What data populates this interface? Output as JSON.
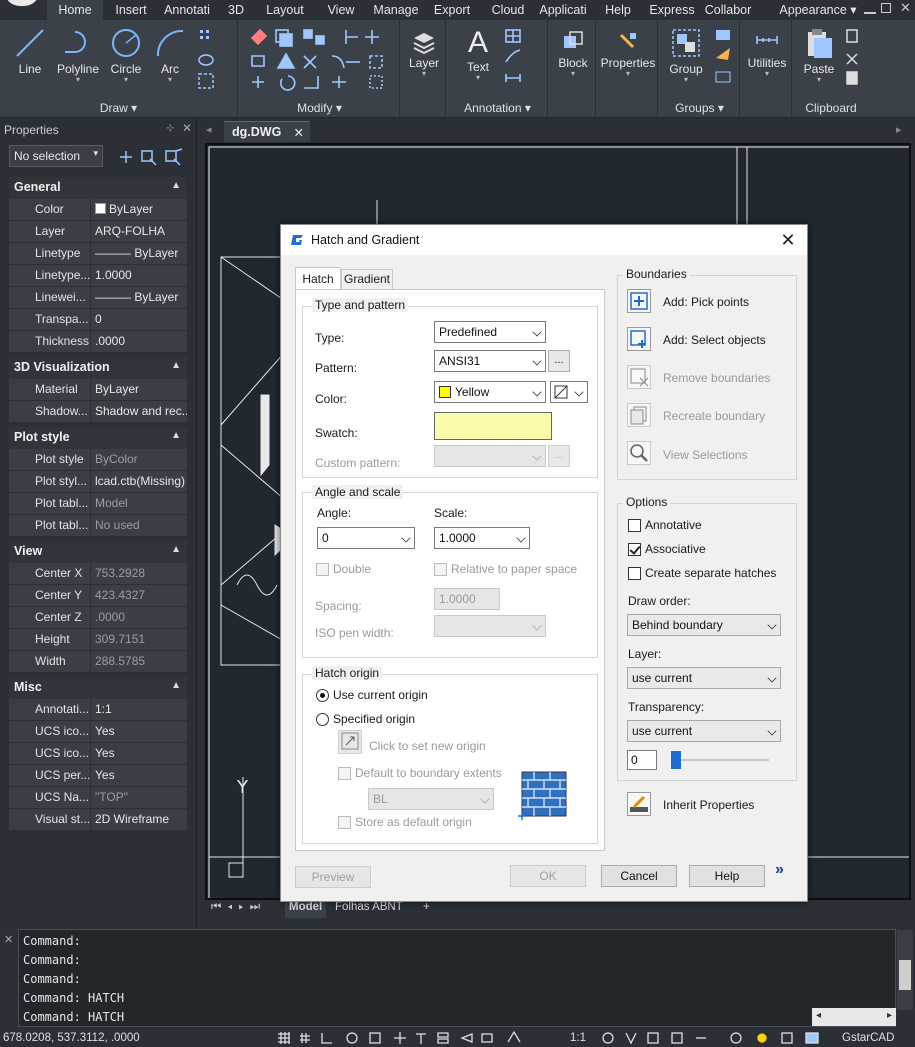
{
  "menu": {
    "tabs": [
      "Home",
      "Insert",
      "Annotati",
      "3D",
      "Layout",
      "View",
      "Manage",
      "Export",
      "Cloud",
      "Applicati",
      "Help",
      "Express",
      "Collabor"
    ],
    "appearance": "Appearance"
  },
  "ribbon": {
    "draw": {
      "label": "Draw",
      "tools": [
        "Line",
        "Polyline",
        "Circle",
        "Arc"
      ]
    },
    "modify": {
      "label": "Modify"
    },
    "layer": "Layer",
    "annotation": {
      "label": "Annotation",
      "text": "Text"
    },
    "block": "Block",
    "properties": "Properties",
    "groups": {
      "label": "Groups",
      "group": "Group"
    },
    "utilities": "Utilities",
    "clipboard": {
      "label": "Clipboard",
      "paste": "Paste"
    }
  },
  "properties_palette": {
    "title": "Properties",
    "selection": "No selection",
    "sections": [
      {
        "title": "General",
        "rows": [
          {
            "k": "Color",
            "v": "ByLayer",
            "swatch": "#ffffff"
          },
          {
            "k": "Layer",
            "v": "ARQ-FOLHA"
          },
          {
            "k": "Linetype",
            "v": "——— ByLayer"
          },
          {
            "k": "Linetype...",
            "v": "1.0000"
          },
          {
            "k": "Linewei...",
            "v": "——— ByLayer"
          },
          {
            "k": "Transpa...",
            "v": "0"
          },
          {
            "k": "Thickness",
            "v": ".0000"
          }
        ]
      },
      {
        "title": "3D Visualization",
        "rows": [
          {
            "k": "Material",
            "v": "ByLayer"
          },
          {
            "k": "Shadow...",
            "v": "Shadow and rec..."
          }
        ]
      },
      {
        "title": "Plot style",
        "rows": [
          {
            "k": "Plot style",
            "v": "ByColor",
            "dim": true
          },
          {
            "k": "Plot styl...",
            "v": "lcad.ctb(Missing)"
          },
          {
            "k": "Plot tabl...",
            "v": "Model",
            "dim": true
          },
          {
            "k": "Plot tabl...",
            "v": "No used",
            "dim": true
          }
        ]
      },
      {
        "title": "View",
        "rows": [
          {
            "k": "Center X",
            "v": "753.2928",
            "dim": true
          },
          {
            "k": "Center Y",
            "v": "423.4327",
            "dim": true
          },
          {
            "k": "Center Z",
            "v": ".0000",
            "dim": true
          },
          {
            "k": "Height",
            "v": "309.7151",
            "dim": true
          },
          {
            "k": "Width",
            "v": "288.5785",
            "dim": true
          }
        ]
      },
      {
        "title": "Misc",
        "rows": [
          {
            "k": "Annotati...",
            "v": "1:1"
          },
          {
            "k": "UCS ico...",
            "v": "Yes"
          },
          {
            "k": "UCS ico...",
            "v": "Yes"
          },
          {
            "k": "UCS per...",
            "v": "Yes"
          },
          {
            "k": "UCS Na...",
            "v": "\"TOP\"",
            "dim": true
          },
          {
            "k": "Visual st...",
            "v": "2D Wireframe"
          }
        ]
      }
    ]
  },
  "document": {
    "tab": "dg.DWG",
    "axis_label": "Y"
  },
  "layout_tabs": [
    "Model",
    "Folhas ABNT",
    "+"
  ],
  "command_lines": [
    "Command:",
    "Command:",
    "Command:",
    "Command: HATCH",
    "Command: HATCH"
  ],
  "status": {
    "coords": "678.0208, 537.3112, .0000",
    "scale": "1:1",
    "app": "GstarCAD"
  },
  "dialog": {
    "title": "Hatch and Gradient",
    "tabs": [
      "Hatch",
      "Gradient"
    ],
    "type_pattern": {
      "title": "Type and pattern",
      "type_label": "Type:",
      "type_value": "Predefined",
      "pattern_label": "Pattern:",
      "pattern_value": "ANSI31",
      "browse": "...",
      "color_label": "Color:",
      "color_value": "Yellow",
      "color_hex": "#ffff00",
      "swatch_label": "Swatch:",
      "custom_label": "Custom pattern:"
    },
    "angle_scale": {
      "title": "Angle and scale",
      "angle_label": "Angle:",
      "angle_value": "0",
      "scale_label": "Scale:",
      "scale_value": "1.0000",
      "double": "Double",
      "relative": "Relative to paper space",
      "spacing_label": "Spacing:",
      "spacing_value": "1.0000",
      "iso_label": "ISO pen width:"
    },
    "origin": {
      "title": "Hatch origin",
      "use_current": "Use current origin",
      "specified": "Specified origin",
      "click_to_set": "Click to set new origin",
      "default_extents": "Default to boundary extents",
      "position": "BL",
      "store_default": "Store as default origin"
    },
    "boundaries": {
      "title": "Boundaries",
      "add_pick": "Add: Pick points",
      "add_select": "Add: Select objects",
      "remove": "Remove boundaries",
      "recreate": "Recreate boundary",
      "view": "View Selections"
    },
    "options": {
      "title": "Options",
      "annotative": "Annotative",
      "associative": "Associative",
      "separate": "Create separate hatches",
      "draw_order_label": "Draw order:",
      "draw_order_value": "Behind boundary",
      "layer_label": "Layer:",
      "layer_value": "use current",
      "transparency_label": "Transparency:",
      "transparency_value": "use current",
      "transparency_num": "0"
    },
    "inherit": "Inherit Properties",
    "buttons": {
      "preview": "Preview",
      "ok": "OK",
      "cancel": "Cancel",
      "help": "Help",
      "more": "»"
    }
  }
}
